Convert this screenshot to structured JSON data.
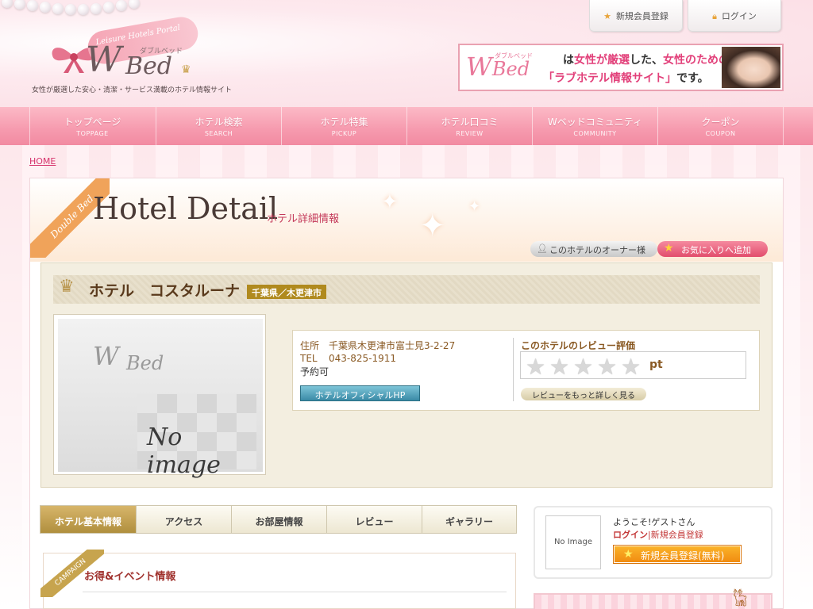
{
  "header": {
    "logo_portal": "Leisure Hotels Portal",
    "logo_w": "W",
    "logo_bed": "Bed",
    "logo_kana": "ダブルベッド",
    "tagline": "女性が厳選した安心・清潔・サービス満載のホテル情報サイト",
    "register_label": "新規会員登録",
    "login_label": "ログイン",
    "banner": {
      "logo_w": "W",
      "logo_bed": "Bed",
      "logo_kana": "ダブルベッド",
      "line1_a": "は",
      "line1_b": "女性が厳選",
      "line1_c": "した、",
      "line1_d": "女性のための",
      "line2_a": "「ラブホテル情報サイト」",
      "line2_b": "です。"
    }
  },
  "nav": [
    {
      "jp": "トップページ",
      "en": "TOPPAGE"
    },
    {
      "jp": "ホテル検索",
      "en": "SEARCH"
    },
    {
      "jp": "ホテル特集",
      "en": "PICKUP"
    },
    {
      "jp": "ホテル口コミ",
      "en": "REVIEW"
    },
    {
      "jp": "Wベッドコミュニティ",
      "en": "COMMUNITY"
    },
    {
      "jp": "クーポン",
      "en": "COUPON"
    }
  ],
  "breadcrumb": {
    "home": "HOME"
  },
  "page": {
    "badge": "Double Bed.",
    "title": "Hotel Detail",
    "subtitle": "ホテル詳細情報",
    "owner_button": "このホテルのオーナー様",
    "favorite_button": "お気に入りへ追加"
  },
  "hotel": {
    "name": "ホテル　コスタルーナ",
    "prefecture": "千葉県／木更津市",
    "image_text": "No image",
    "address_label": "住所",
    "address": "千葉県木更津市富士見3-2-27",
    "tel_label": "TEL",
    "tel": "043-825-1911",
    "reservation": "予約可",
    "official_button": "ホテルオフィシャルHP",
    "review_label": "このホテルのレビュー評価",
    "review_stars": 0,
    "review_points": "pt",
    "review_more": "レビューをもっと詳しく見る"
  },
  "tabs": [
    "ホテル基本情報",
    "アクセス",
    "お部屋情報",
    "レビュー",
    "ギャラリー"
  ],
  "campaign": {
    "badge": "CAMPAIGN",
    "title": "お得&イベント情報"
  },
  "sidebar": {
    "avatar_text": "No Image",
    "welcome": "ようこそ!ゲストさん",
    "login": "ログイン",
    "register": "新規会員登録",
    "register_button": "新規会員登録(無料)"
  }
}
